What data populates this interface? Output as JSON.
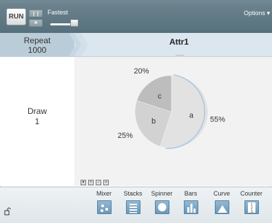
{
  "toolbar": {
    "run_label": "RUN",
    "pause_glyph": "❙❙",
    "step_glyph": "■",
    "speed_label": "Fastest",
    "options_label": "Options ▾"
  },
  "header": {
    "repeat_label": "Repeat",
    "repeat_value": "1000",
    "attribute_label": "Attr1",
    "attribute_underline": "___"
  },
  "draw": {
    "label": "Draw",
    "value": "1"
  },
  "mini_controls": [
    "▾",
    "+",
    "−",
    "="
  ],
  "palette": {
    "tools": [
      "Mixer",
      "Stacks",
      "Spinner",
      "Bars",
      "Curve",
      "Counter"
    ]
  },
  "chart_data": {
    "type": "pie",
    "title": "",
    "slices": [
      {
        "label": "a",
        "value": 55,
        "percent_label": "55%",
        "color": "#e2e2e2"
      },
      {
        "label": "b",
        "value": 25,
        "percent_label": "25%",
        "color": "#d2d2d2"
      },
      {
        "label": "c",
        "value": 20,
        "percent_label": "20%",
        "color": "#bdbdbd"
      }
    ],
    "outline_color": "#a9c6e4"
  }
}
